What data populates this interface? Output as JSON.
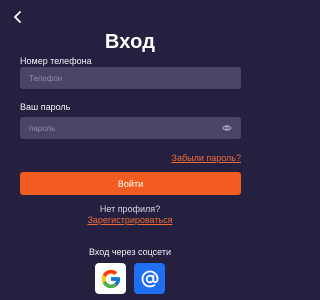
{
  "header": {
    "title": "Вход"
  },
  "phone": {
    "label": "Номер телефона",
    "placeholder": "Телефон",
    "value": ""
  },
  "password": {
    "label": "Ваш пароль",
    "placeholder": "пароль",
    "value": ""
  },
  "forgot_label": "Забыли пароль?",
  "login_label": "Войти",
  "no_profile_text": "Нет профиля?",
  "register_label": "Зарегистрироваться",
  "social": {
    "title": "Вход через соцсети",
    "icons": [
      "google-icon",
      "mail-icon"
    ]
  },
  "colors": {
    "background": "#25203f",
    "input_background": "#4a4566",
    "accent": "#f25c20",
    "link": "#ee6a35",
    "mail_brand": "#1e6ff2"
  },
  "icons": {
    "back": "chevron-left-icon",
    "password_toggle": "eye-icon"
  }
}
